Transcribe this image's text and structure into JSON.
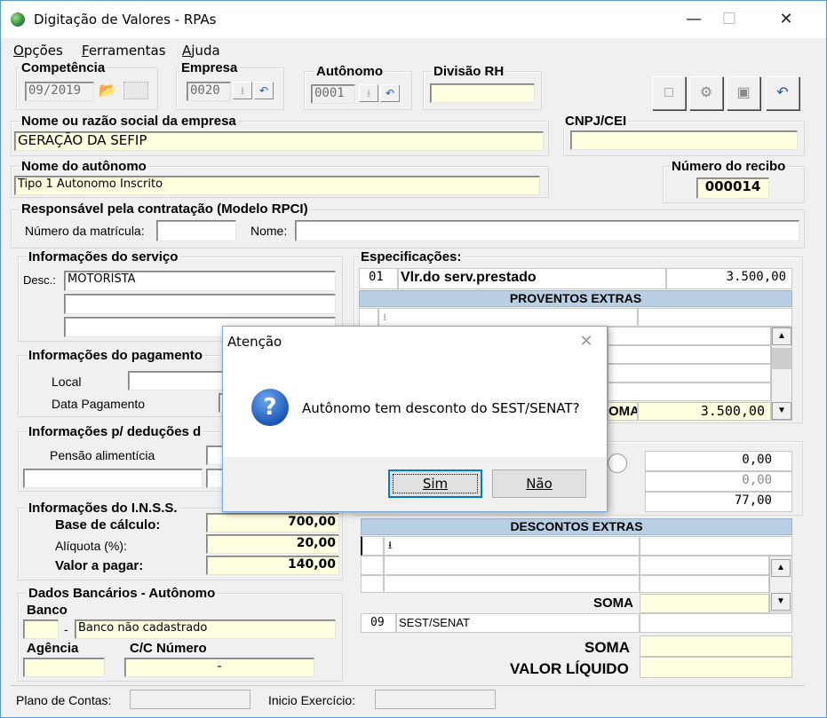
{
  "window": {
    "title": "Digitação de Valores - RPAs",
    "minimize": "—",
    "maximize": "☐",
    "close": "✕"
  },
  "menu": [
    {
      "label": "Opções",
      "u": "O"
    },
    {
      "label": "Ferramentas",
      "u": "F"
    },
    {
      "label": "Ajuda",
      "u": "A"
    }
  ],
  "competencia": {
    "label": "Competência",
    "value": "09/2019"
  },
  "empresa": {
    "label": "Empresa",
    "value": "0020"
  },
  "autonomo": {
    "label": "Autônomo",
    "value": "0001"
  },
  "divisao": {
    "label": "Divisão RH",
    "value": ""
  },
  "nome_empresa": {
    "label": "Nome ou razão social da empresa",
    "value": "GERAÇÃO DA SEFIP"
  },
  "cnpj": {
    "label": "CNPJ/CEI",
    "value": ""
  },
  "nome_autonomo": {
    "label": "Nome do autônomo",
    "value": "Tipo 1 Autonomo Inscrito"
  },
  "recibo": {
    "label": "Número do recibo",
    "value": "000014"
  },
  "responsavel": {
    "label": "Responsável pela contratação (Modelo RPCI)",
    "matricula_label": "Número da matrícula:",
    "matricula": "",
    "nome_label": "Nome:",
    "nome": ""
  },
  "servico": {
    "label": "Informações do serviço",
    "desc_label": "Desc.:",
    "lines": [
      "MOTORISTA",
      "",
      ""
    ]
  },
  "pagamento": {
    "label": "Informações do pagamento",
    "local_label": "Local",
    "data_label": "Data Pagamento"
  },
  "deducoes": {
    "label": "Informações p/ deduções d",
    "pensao_label": "Pensão alimentícia"
  },
  "inss": {
    "label": "Informações do I.N.S.S.",
    "base_label": "Base de cálculo:",
    "base": "700,00",
    "aliquota_label": "Alíquota (%):",
    "aliquota": "20,00",
    "valor_label": "Valor a pagar:",
    "valor": "140,00"
  },
  "bancarios": {
    "label": "Dados Bancários - Autônomo",
    "banco_label": "Banco",
    "banco_code": "",
    "banco_sep": "-",
    "banco_nome": "Banco não cadastrado",
    "agencia_label": "Agência",
    "cc_label": "C/C Número",
    "agencia": "",
    "cc": "-"
  },
  "especificacoes": {
    "label": "Especificações:",
    "row1_code": "01",
    "row1_desc": "Vlr.do serv.prestado",
    "row1_value": "3.500,00",
    "proventos_header": "PROVENTOS EXTRAS",
    "soma_partial": "OMA",
    "soma_value": "3.500,00",
    "mid_values": [
      "0,00",
      "0,00",
      "77,00"
    ],
    "descontos_header": "DESCONTOS EXTRAS",
    "soma_label": "SOMA",
    "row9_code": "09",
    "row9_desc": "SEST/SENAT",
    "soma_final_label": "SOMA",
    "liquido_label": "VALOR LÍQUIDO"
  },
  "status": {
    "plano_label": "Plano de Contas:",
    "inicio_label": "Inicio Exercício:"
  },
  "dialog": {
    "title": "Atenção",
    "message": "Autônomo tem desconto do SEST/SENAT?",
    "yes": "Sim",
    "no": "Não",
    "close": "✕",
    "icon_glyph": "?"
  },
  "icons": {
    "dropdown": "⭳",
    "undo": "↶",
    "folder": "📂",
    "up": "▲",
    "down": "▼"
  }
}
